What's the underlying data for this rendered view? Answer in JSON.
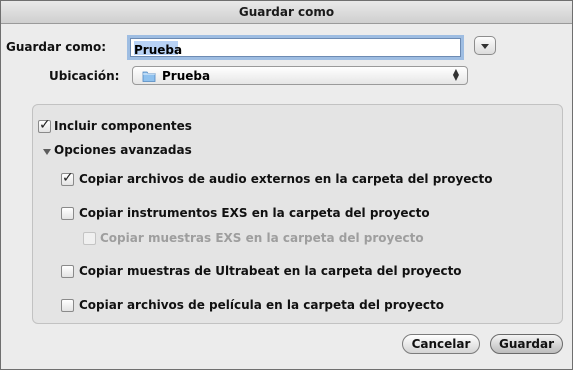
{
  "dialog": {
    "title": "Guardar como",
    "save_as_label": "Guardar como:",
    "filename_value": "Prueba",
    "location_label": "Ubicación:",
    "location_value": "Prueba",
    "include_components_label": "Incluir componentes",
    "include_components_checked": true,
    "advanced_options_label": "Opciones avanzadas",
    "options": [
      {
        "label": "Copiar archivos de audio externos en la carpeta del proyecto",
        "checked": true,
        "enabled": true
      },
      {
        "label": "Copiar instrumentos EXS en la carpeta del proyecto",
        "checked": false,
        "enabled": true
      },
      {
        "label": "Copiar muestras EXS en la carpeta del proyecto",
        "checked": false,
        "enabled": false
      },
      {
        "label": "Copiar muestras de Ultrabeat en la carpeta del proyecto",
        "checked": false,
        "enabled": true
      },
      {
        "label": "Copiar archivos de película en la carpeta del proyecto",
        "checked": false,
        "enabled": true
      }
    ],
    "cancel_label": "Cancelar",
    "save_label": "Guardar"
  }
}
